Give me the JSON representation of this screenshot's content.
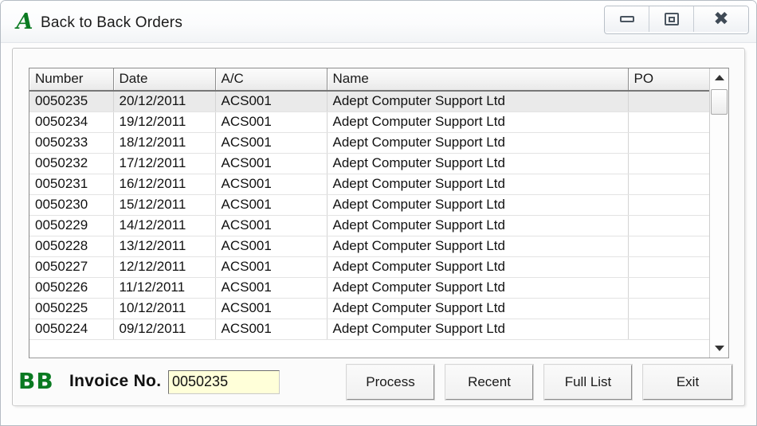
{
  "window": {
    "title": "Back to Back Orders",
    "app_icon": "A",
    "controls": {
      "minimize": "minimize-icon",
      "maximize": "maximize-icon",
      "close": "close-icon"
    }
  },
  "grid": {
    "columns": [
      "Number",
      "Date",
      "A/C",
      "Name",
      "PO"
    ],
    "selected_row_index": 0,
    "rows": [
      {
        "number": "0050235",
        "date": "20/12/2011",
        "ac": "ACS001",
        "name": "Adept Computer Support Ltd",
        "po": ""
      },
      {
        "number": "0050234",
        "date": "19/12/2011",
        "ac": "ACS001",
        "name": "Adept Computer Support Ltd",
        "po": ""
      },
      {
        "number": "0050233",
        "date": "18/12/2011",
        "ac": "ACS001",
        "name": "Adept Computer Support Ltd",
        "po": ""
      },
      {
        "number": "0050232",
        "date": "17/12/2011",
        "ac": "ACS001",
        "name": "Adept Computer Support Ltd",
        "po": ""
      },
      {
        "number": "0050231",
        "date": "16/12/2011",
        "ac": "ACS001",
        "name": "Adept Computer Support Ltd",
        "po": ""
      },
      {
        "number": "0050230",
        "date": "15/12/2011",
        "ac": "ACS001",
        "name": "Adept Computer Support Ltd",
        "po": ""
      },
      {
        "number": "0050229",
        "date": "14/12/2011",
        "ac": "ACS001",
        "name": "Adept Computer Support Ltd",
        "po": ""
      },
      {
        "number": "0050228",
        "date": "13/12/2011",
        "ac": "ACS001",
        "name": "Adept Computer Support Ltd",
        "po": ""
      },
      {
        "number": "0050227",
        "date": "12/12/2011",
        "ac": "ACS001",
        "name": "Adept Computer Support Ltd",
        "po": ""
      },
      {
        "number": "0050226",
        "date": "11/12/2011",
        "ac": "ACS001",
        "name": "Adept Computer Support Ltd",
        "po": ""
      },
      {
        "number": "0050225",
        "date": "10/12/2011",
        "ac": "ACS001",
        "name": "Adept Computer Support Ltd",
        "po": ""
      },
      {
        "number": "0050224",
        "date": "09/12/2011",
        "ac": "ACS001",
        "name": "Adept Computer Support Ltd",
        "po": ""
      }
    ],
    "scrollbar": {
      "up_icon": "scroll-up-arrow-icon",
      "down_icon": "scroll-down-arrow-icon"
    }
  },
  "footer": {
    "logo": "BB",
    "invoice_label": "Invoice No.",
    "invoice_value": "0050235",
    "invoice_placeholder": "",
    "buttons": {
      "process": "Process",
      "recent": "Recent",
      "full_list": "Full List",
      "exit": "Exit"
    }
  },
  "colors": {
    "brand_green": "#0a7a21",
    "input_background": "#ffffd9",
    "selected_row": "#eaeaea"
  }
}
